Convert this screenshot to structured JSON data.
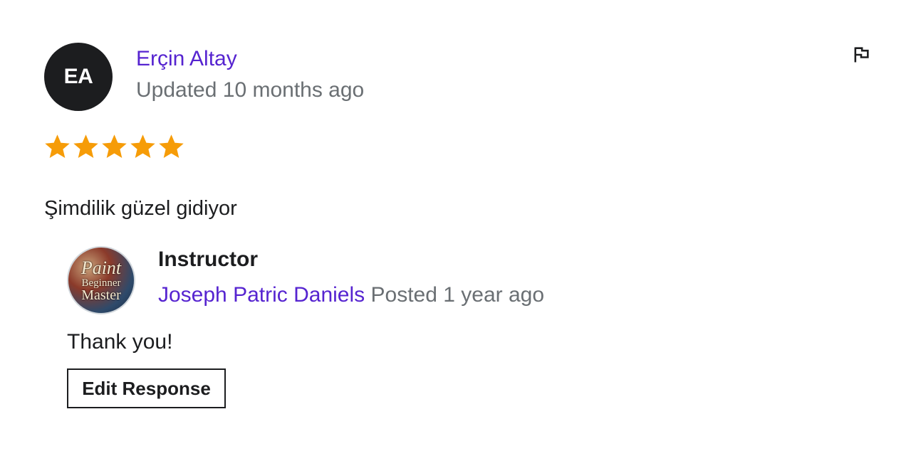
{
  "review": {
    "avatar_initials": "EA",
    "reviewer_name": "Erçin Altay",
    "date_text": "Updated 10 months ago",
    "rating": 5,
    "max_rating": 5,
    "star_color": "#f69c08",
    "text": "Şimdilik güzel gidiyor",
    "flag_icon": "flag-icon"
  },
  "response": {
    "avatar_logo_words": [
      "Paint",
      "Beginner",
      "Master"
    ],
    "role": "Instructor",
    "instructor_name": "Joseph Patric Daniels",
    "date_text": "Posted 1 year ago",
    "text": "Thank you!",
    "edit_button_label": "Edit Response"
  },
  "colors": {
    "link": "#5624d0",
    "muted": "#6a6f73",
    "text": "#1c1d1f"
  }
}
